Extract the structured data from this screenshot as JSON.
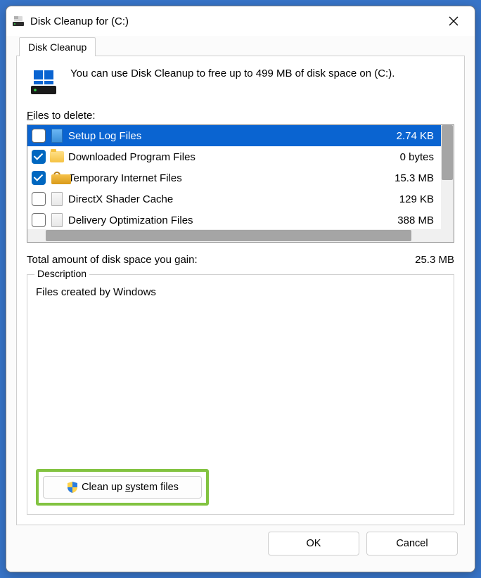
{
  "window": {
    "title": "Disk Cleanup for  (C:)"
  },
  "tab": {
    "label": "Disk Cleanup"
  },
  "intro": {
    "text": "You can use Disk Cleanup to free up to 499 MB of disk space on  (C:)."
  },
  "files_label_pre": "F",
  "files_label_post": "iles to delete:",
  "rows": [
    {
      "checked": false,
      "selected": true,
      "icon": "file-blue",
      "name": "Setup Log Files",
      "size": "2.74 KB"
    },
    {
      "checked": true,
      "selected": false,
      "icon": "folder",
      "name": "Downloaded Program Files",
      "size": "0 bytes"
    },
    {
      "checked": true,
      "selected": false,
      "icon": "lock",
      "name": "Temporary Internet Files",
      "size": "15.3 MB"
    },
    {
      "checked": false,
      "selected": false,
      "icon": "file",
      "name": "DirectX Shader Cache",
      "size": "129 KB"
    },
    {
      "checked": false,
      "selected": false,
      "icon": "file",
      "name": "Delivery Optimization Files",
      "size": "388 MB"
    }
  ],
  "total": {
    "label": "Total amount of disk space you gain:",
    "value": "25.3 MB"
  },
  "description": {
    "legend": "Description",
    "text": "Files created by Windows"
  },
  "system_button": {
    "pre": "Clean up ",
    "u": "s",
    "post": "ystem files"
  },
  "footer": {
    "ok": "OK",
    "cancel": "Cancel"
  }
}
